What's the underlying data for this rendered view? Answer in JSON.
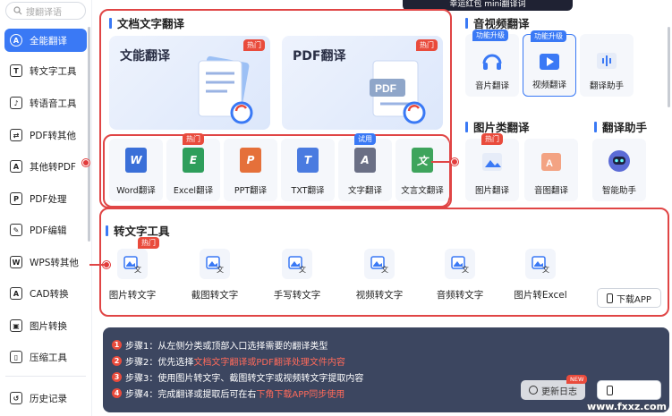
{
  "sidebar": {
    "search_placeholder": "搜翻译语",
    "items": [
      {
        "label": "全能翻译",
        "icon": "translate-icon",
        "glyph": "A"
      },
      {
        "label": "转文字工具",
        "icon": "text-icon",
        "glyph": "T"
      },
      {
        "label": "转语音工具",
        "icon": "voice-icon",
        "glyph": "♪"
      },
      {
        "label": "PDF转其他",
        "icon": "pdf-convert-icon",
        "glyph": "⇄"
      },
      {
        "label": "其他转PDF",
        "icon": "to-pdf-icon",
        "glyph": "A"
      },
      {
        "label": "PDF处理",
        "icon": "pdf-process-icon",
        "glyph": "P"
      },
      {
        "label": "PDF编辑",
        "icon": "pdf-edit-icon",
        "glyph": "✎"
      },
      {
        "label": "WPS转其他",
        "icon": "wps-icon",
        "glyph": "W"
      },
      {
        "label": "CAD转换",
        "icon": "cad-icon",
        "glyph": "A"
      },
      {
        "label": "图片转换",
        "icon": "image-icon",
        "glyph": "▣"
      },
      {
        "label": "压缩工具",
        "icon": "compress-icon",
        "glyph": "▯"
      },
      {
        "label": "历史记录",
        "icon": "history-icon",
        "glyph": "↺"
      }
    ]
  },
  "topbar": {
    "text": "幸运红包 mini翻译词"
  },
  "doc_section": {
    "title": "文档文字翻译",
    "cards": [
      {
        "title": "文能翻译",
        "badge": "热门"
      },
      {
        "title": "PDF翻译",
        "badge": "热门"
      }
    ],
    "formats": [
      {
        "label": "Word翻译",
        "glyph": "W",
        "color": "#3a6fd8",
        "badge": ""
      },
      {
        "label": "Excel翻译",
        "glyph": "E",
        "color": "#2e9e5b",
        "badge": "热门"
      },
      {
        "label": "PPT翻译",
        "glyph": "P",
        "color": "#e5703a",
        "badge": ""
      },
      {
        "label": "TXT翻译",
        "glyph": "T",
        "color": "#4a7be0",
        "badge": ""
      },
      {
        "label": "文字翻译",
        "glyph": "A",
        "color": "#6a6f85",
        "badge": "试用"
      },
      {
        "label": "文言文翻译",
        "glyph": "文",
        "color": "#3ea45c",
        "badge": ""
      }
    ]
  },
  "av_section": {
    "title": "音视频翻译",
    "items": [
      {
        "label": "音片翻译",
        "badge": "功能升级"
      },
      {
        "label": "视频翻译",
        "badge": "功能升级"
      },
      {
        "label": "翻译助手",
        "badge": ""
      }
    ]
  },
  "img_section": {
    "title": "图片类翻译",
    "items": [
      {
        "label": "图片翻译",
        "badge": "热门"
      },
      {
        "label": "音图翻译",
        "badge": ""
      }
    ]
  },
  "assistant_section": {
    "title": "翻译助手",
    "item": {
      "label": "智能助手"
    }
  },
  "text_tools": {
    "title": "转文字工具",
    "items": [
      {
        "label": "图片转文字",
        "badge": "热门"
      },
      {
        "label": "截图转文字",
        "badge": ""
      },
      {
        "label": "手写转文字",
        "badge": ""
      },
      {
        "label": "视频转文字",
        "badge": ""
      },
      {
        "label": "音频转文字",
        "badge": ""
      },
      {
        "label": "图片转Excel",
        "badge": ""
      }
    ],
    "download_label": "下载APP"
  },
  "steps": [
    {
      "num": "1",
      "text": "步骤1：从左侧分类或顶部入口选择需要的翻译类型",
      "hl": ""
    },
    {
      "num": "2",
      "text": "步骤2：优先选择",
      "hl": "文档文字翻译或PDF翻译处理文件内容"
    },
    {
      "num": "3",
      "text": "步骤3：使用图片转文字、截图转文字或视频转文字提取内容",
      "hl": ""
    },
    {
      "num": "4",
      "text": "步骤4：完成翻译或提取后可在右",
      "hl": "下角下载APP同步使用"
    }
  ],
  "bottom_buttons": {
    "log_label": "更新日志",
    "log_badge": "NEW",
    "download_label": "下载APP"
  },
  "watermark": "www.fxxz.com"
}
